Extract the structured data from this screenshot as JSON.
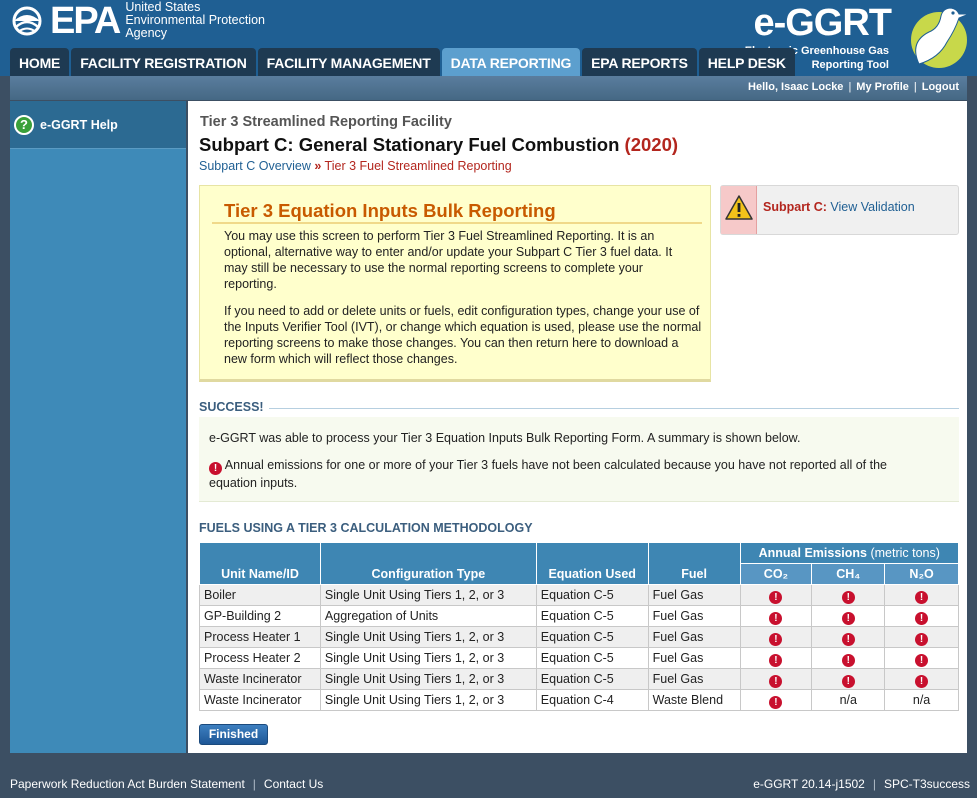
{
  "header": {
    "epa_logo_text": "EPA",
    "agency_lines": [
      "United States",
      "Environmental Protection",
      "Agency"
    ],
    "app_logo_title": "e-GGRT",
    "app_logo_sub": [
      "Electronic Greenhouse Gas",
      "Reporting Tool"
    ]
  },
  "nav": {
    "tabs": [
      {
        "label": "HOME",
        "active": false
      },
      {
        "label": "FACILITY REGISTRATION",
        "active": false
      },
      {
        "label": "FACILITY MANAGEMENT",
        "active": false
      },
      {
        "label": "DATA REPORTING",
        "active": true
      },
      {
        "label": "EPA REPORTS",
        "active": false
      },
      {
        "label": "HELP DESK",
        "active": false
      }
    ]
  },
  "userbar": {
    "greeting": "Hello, Isaac Locke",
    "profile": "My Profile",
    "logout": "Logout"
  },
  "sidebar": {
    "help_label": "e-GGRT Help"
  },
  "page": {
    "facility": "Tier 3 Streamlined Reporting Facility",
    "title": "Subpart C: General Stationary Fuel Combustion",
    "year": "(2020)",
    "breadcrumb_link": "Subpart C Overview",
    "breadcrumb_sep": "»",
    "breadcrumb_current": "Tier 3 Fuel Streamlined Reporting"
  },
  "info": {
    "heading": "Tier 3 Equation Inputs Bulk Reporting",
    "p1": "You may use this screen to perform Tier 3 Fuel Streamlined Reporting. It is an optional, alternative way to enter and/or update your Subpart C Tier 3 fuel data. It may still be necessary to use the normal reporting screens to complete your reporting.",
    "p2": "If you need to add or delete units or fuels, edit configuration types, change your use of the Inputs Verifier Tool (IVT), or change which equation is used, please use the normal reporting screens to make those changes. You can then return here to download a new form which will reflect those changes."
  },
  "validation": {
    "label": "Subpart C:",
    "link": "View Validation"
  },
  "success": {
    "heading": "SUCCESS!",
    "message": "e-GGRT was able to process your Tier 3 Equation Inputs Bulk Reporting Form. A summary is shown below.",
    "warning": "Annual emissions for one or more of your Tier 3 fuels have not been calculated because you have not reported all of the equation inputs."
  },
  "fuels": {
    "heading": "FUELS USING A TIER 3 CALCULATION METHODOLOGY",
    "headers": {
      "unit": "Unit Name/ID",
      "config": "Configuration Type",
      "equation": "Equation Used",
      "fuel": "Fuel",
      "annual": "Annual Emissions",
      "annual_unit": "(metric tons)",
      "co2": "CO₂",
      "ch4": "CH₄",
      "n2o": "N₂O"
    },
    "rows": [
      {
        "unit": "Boiler",
        "config": "Single Unit Using Tiers 1, 2, or 3",
        "equation": "Equation C-5",
        "fuel": "Fuel Gas",
        "co2": "!",
        "ch4": "!",
        "n2o": "!"
      },
      {
        "unit": "GP-Building 2",
        "config": "Aggregation of Units",
        "equation": "Equation C-5",
        "fuel": "Fuel Gas",
        "co2": "!",
        "ch4": "!",
        "n2o": "!"
      },
      {
        "unit": "Process Heater 1",
        "config": "Single Unit Using Tiers 1, 2, or 3",
        "equation": "Equation C-5",
        "fuel": "Fuel Gas",
        "co2": "!",
        "ch4": "!",
        "n2o": "!"
      },
      {
        "unit": "Process Heater 2",
        "config": "Single Unit Using Tiers 1, 2, or 3",
        "equation": "Equation C-5",
        "fuel": "Fuel Gas",
        "co2": "!",
        "ch4": "!",
        "n2o": "!"
      },
      {
        "unit": "Waste Incinerator",
        "config": "Single Unit Using Tiers 1, 2, or 3",
        "equation": "Equation C-5",
        "fuel": "Fuel Gas",
        "co2": "!",
        "ch4": "!",
        "n2o": "!"
      },
      {
        "unit": "Waste Incinerator",
        "config": "Single Unit Using Tiers 1, 2, or 3",
        "equation": "Equation C-4",
        "fuel": "Waste Blend",
        "co2": "!",
        "ch4": "n/a",
        "n2o": "n/a"
      }
    ],
    "finished_label": "Finished"
  },
  "footer": {
    "paperwork": "Paperwork Reduction Act Burden Statement",
    "contact": "Contact Us",
    "version": "e-GGRT 20.14-j1502",
    "code": "SPC-T3success"
  },
  "colors": {
    "header_blue": "#1f5f93",
    "active_tab": "#5c9fce",
    "table_header": "#3e86b3",
    "error_red": "#c8102e",
    "accent_orange": "#c85a00"
  }
}
